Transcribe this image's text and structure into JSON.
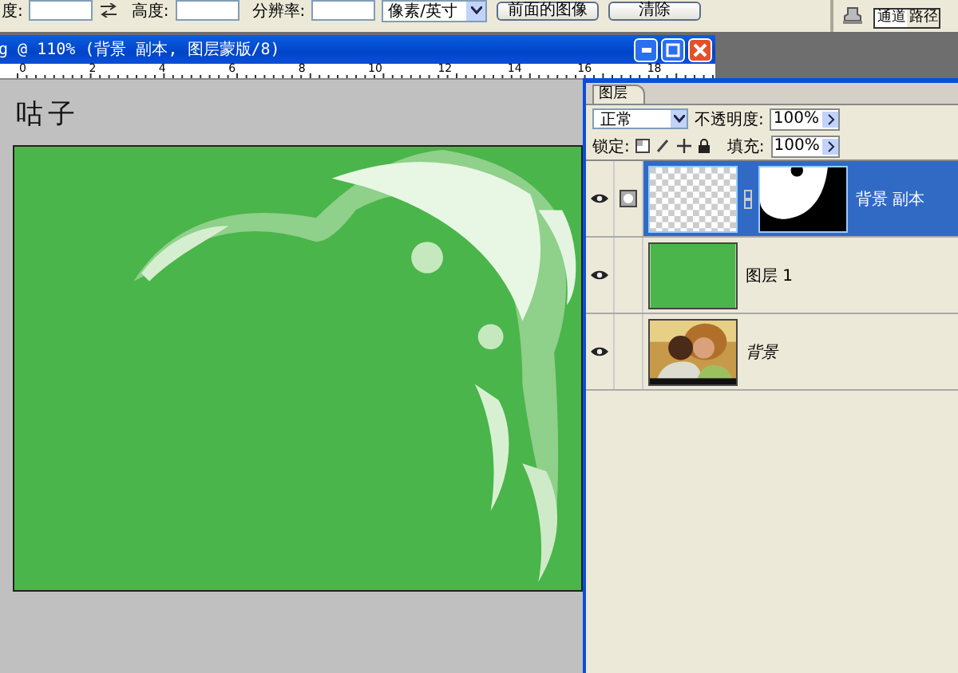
{
  "toolbar": {
    "fields": [
      {
        "label": "度:"
      },
      {
        "label": "高度:"
      },
      {
        "label": "分辨率:"
      }
    ],
    "unit_select": "像素/英寸",
    "buttons": [
      "前面的图像",
      "清除"
    ],
    "palette_tabs": [
      {
        "label": "通道",
        "selected": true
      },
      {
        "label": "路径",
        "selected": false
      }
    ]
  },
  "document": {
    "title": "g @ 110% (背景 副本, 图层蒙版/8)",
    "ruler_labels": [
      "0",
      "2",
      "4",
      "6",
      "8",
      "10",
      "12",
      "14",
      "16",
      "18"
    ],
    "signature": "咕子"
  },
  "layers_panel": {
    "tab": "图层",
    "blend_mode": "正常",
    "opacity_label": "不透明度:",
    "opacity": "100%",
    "lock_label": "锁定:",
    "fill_label": "填充:",
    "fill": "100%",
    "layers": [
      {
        "name": "背景 副本",
        "kind": "masked",
        "visible": true,
        "selected": true
      },
      {
        "name": "图层 1",
        "kind": "fill",
        "visible": true,
        "selected": false
      },
      {
        "name": "背景",
        "visible": true,
        "selected": false
      }
    ]
  }
}
